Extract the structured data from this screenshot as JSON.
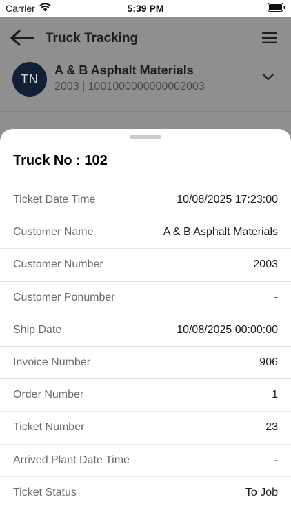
{
  "status_bar": {
    "carrier": "Carrier",
    "time": "5:39 PM"
  },
  "header": {
    "title": "Truck Tracking",
    "back_icon": "arrow-left-icon",
    "menu_icon": "hamburger-menu-icon"
  },
  "account": {
    "initials": "TN",
    "name": "A & B Asphalt Materials",
    "subtitle": "2003 | 1001000000000002003",
    "expand_icon": "chevron-down-icon"
  },
  "sheet": {
    "title": "Truck No : 102",
    "rows": [
      {
        "label": "Ticket Date Time",
        "value": "10/08/2025 17:23:00"
      },
      {
        "label": "Customer Name",
        "value": "A & B Asphalt Materials"
      },
      {
        "label": "Customer Number",
        "value": "2003"
      },
      {
        "label": "Customer Ponumber",
        "value": "-"
      },
      {
        "label": "Ship Date",
        "value": "10/08/2025 00:00:00"
      },
      {
        "label": "Invoice Number",
        "value": "906"
      },
      {
        "label": "Order Number",
        "value": "1"
      },
      {
        "label": "Ticket Number",
        "value": "23"
      },
      {
        "label": "Arrived Plant Date Time",
        "value": "-"
      },
      {
        "label": "Ticket Status",
        "value": "To Job"
      }
    ]
  },
  "colors": {
    "overlay_background": "#8f8f8f",
    "avatar": "#122033",
    "sheet": "#ffffff"
  }
}
